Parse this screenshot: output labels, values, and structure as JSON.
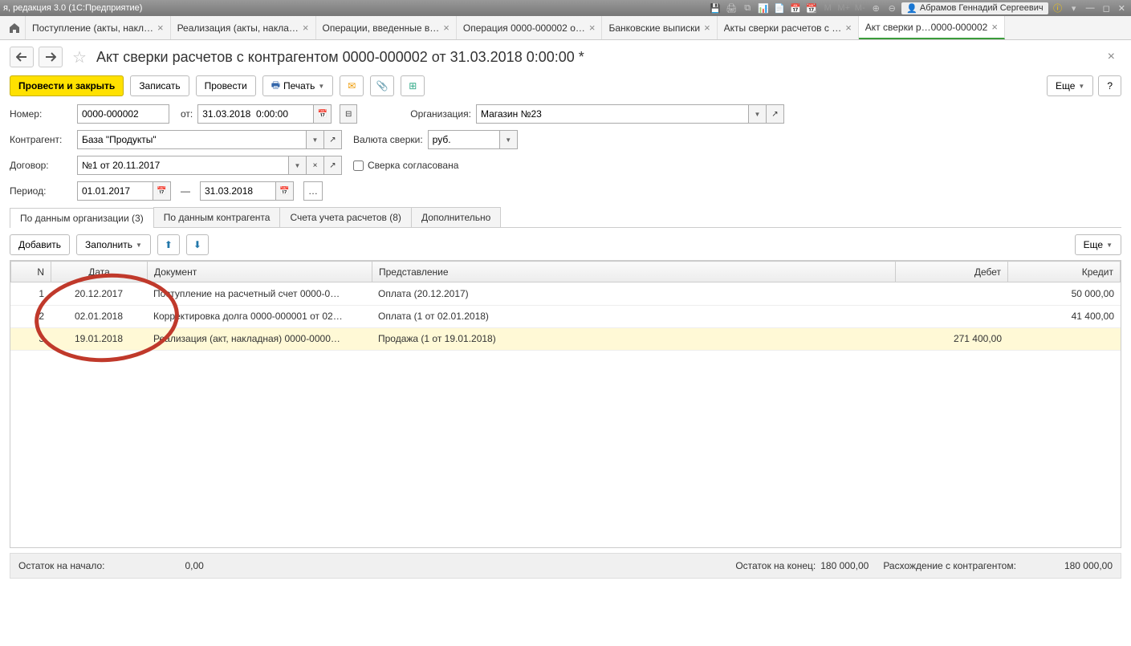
{
  "titlebar": {
    "app_title": "я, редакция 3.0  (1С:Предприятие)",
    "m_labels": [
      "M",
      "M+",
      "M-"
    ],
    "user_name": "Абрамов Геннадий Сергеевич"
  },
  "tabs": [
    {
      "label": "Поступление (акты, накл…"
    },
    {
      "label": "Реализация (акты, накла…"
    },
    {
      "label": "Операции, введенные в…"
    },
    {
      "label": "Операция 0000-000002 о…"
    },
    {
      "label": "Банковские выписки"
    },
    {
      "label": "Акты сверки расчетов с …"
    },
    {
      "label": "Акт сверки р…0000-000002",
      "active": true
    }
  ],
  "page_title": "Акт сверки расчетов с контрагентом 0000-000002 от 31.03.2018 0:00:00 *",
  "toolbar": {
    "post_close": "Провести и закрыть",
    "record": "Записать",
    "post": "Провести",
    "print": "Печать",
    "more": "Еще",
    "help": "?"
  },
  "form": {
    "number_label": "Номер:",
    "number_value": "0000-000002",
    "from_label": "от:",
    "date_value": "31.03.2018  0:00:00",
    "org_label": "Организация:",
    "org_value": "Магазин №23",
    "contragent_label": "Контрагент:",
    "contragent_value": "База \"Продукты\"",
    "currency_label": "Валюта сверки:",
    "currency_value": "руб.",
    "contract_label": "Договор:",
    "contract_value": "№1 от 20.11.2017",
    "agreed_label": "Сверка согласована",
    "period_label": "Период:",
    "period_from": "01.01.2017",
    "period_to": "31.03.2018",
    "dash": "—"
  },
  "tabstrip": [
    {
      "label": "По данным организации (3)",
      "active": true
    },
    {
      "label": "По данным контрагента"
    },
    {
      "label": "Счета учета расчетов (8)"
    },
    {
      "label": "Дополнительно"
    }
  ],
  "tbl_toolbar": {
    "add": "Добавить",
    "fill": "Заполнить",
    "more": "Еще"
  },
  "columns": {
    "n": "N",
    "date": "Дата",
    "doc": "Документ",
    "repr": "Представление",
    "debit": "Дебет",
    "credit": "Кредит"
  },
  "rows": [
    {
      "n": "1",
      "date": "20.12.2017",
      "doc": "Поступление на расчетный счет 0000-0…",
      "repr": "Оплата (20.12.2017)",
      "debit": "",
      "credit": "50 000,00"
    },
    {
      "n": "2",
      "date": "02.01.2018",
      "doc": "Корректировка долга 0000-000001 от 02…",
      "repr": "Оплата (1 от 02.01.2018)",
      "debit": "",
      "credit": "41 400,00"
    },
    {
      "n": "3",
      "date": "19.01.2018",
      "doc": "Реализация (акт, накладная) 0000-0000…",
      "repr": "Продажа (1 от 19.01.2018)",
      "debit": "271 400,00",
      "credit": "",
      "selected": true
    }
  ],
  "footer": {
    "start_label": "Остаток на начало:",
    "start_value": "0,00",
    "end_label": "Остаток на конец:",
    "end_value": "180 000,00",
    "diff_label": "Расхождение с контрагентом:",
    "diff_value": "180 000,00"
  }
}
